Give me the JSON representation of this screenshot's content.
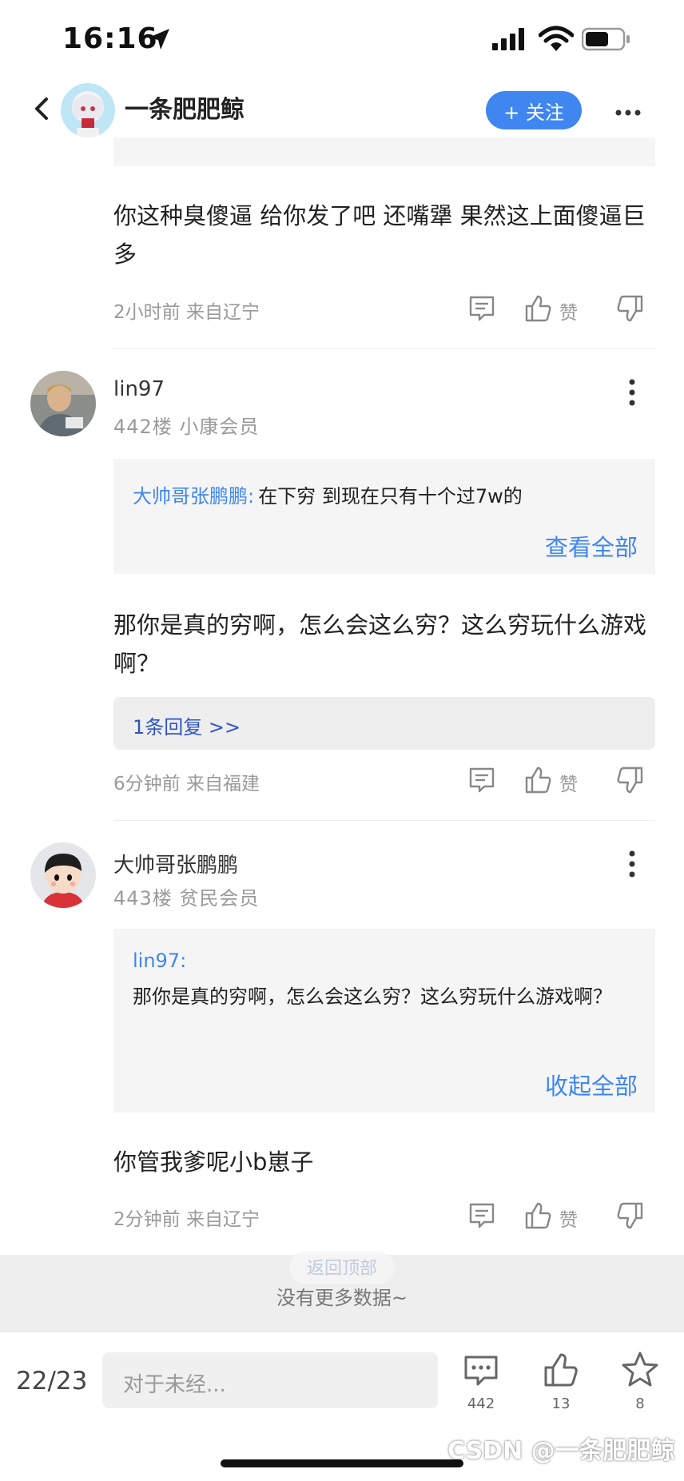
{
  "status_bar": {
    "time": "16:16"
  },
  "header": {
    "name": "一条肥肥鲸",
    "follow_label": "+ 关注"
  },
  "posts": [
    {
      "content": "你这种臭傻逼 给你发了吧 还嘴犟 果然这上面傻逼巨多",
      "meta": "2小时前 来自辽宁",
      "like_label": "赞"
    },
    {
      "username": "lin97",
      "floor": "442楼 小康会员",
      "quote_name": "大帅哥张鹏鹏:",
      "quote_text": "在下穷 到现在只有十个过7w的",
      "quote_link": "查看全部",
      "content": "那你是真的穷啊，怎么会这么穷？这么穷玩什么游戏啊？",
      "reply_link": "1条回复 >>",
      "meta": "6分钟前 来自福建",
      "like_label": "赞"
    },
    {
      "username": "大帅哥张鹏鹏",
      "floor": "443楼 贫民会员",
      "quote_name": "lin97:",
      "quote_text": "那你是真的穷啊，怎么会这么穷？这么穷玩什么游戏啊？",
      "quote_link": "收起全部",
      "content": "你管我爹呢小b崽子",
      "meta": "2分钟前 来自辽宁",
      "like_label": "赞"
    }
  ],
  "back_to_top": "返回顶部",
  "no_more": "没有更多数据~",
  "bottom_bar": {
    "page_indicator": "22/23",
    "input_placeholder": "对于未经...",
    "comment_count": "442",
    "like_count": "13",
    "star_count": "8"
  },
  "watermark": "CSDN @一条肥肥鲸"
}
